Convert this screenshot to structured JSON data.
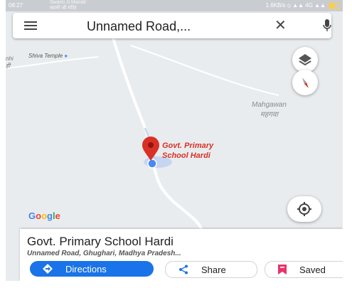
{
  "status_bar": {
    "notification_line1": "Swami Ji Mandir",
    "notification_line2": "स्वामी जी मंदिर",
    "left_text": "08:27",
    "right_text": "1.6KB/s ⦸ ▲▲ 4G ▲▲"
  },
  "search": {
    "query": "Unnamed Road,...",
    "menu_icon": "hamburger-menu-icon",
    "close_icon": "close-icon",
    "mic_icon": "microphone-icon"
  },
  "map": {
    "labels": {
      "shiva_temple": "Shiva Temple",
      "nhi_left": "nhi",
      "nhi_left_hindi": "ही",
      "mahgawan": "Mahgawan",
      "mahgawan_hindi": "महगवा",
      "school_line1": "Govt. Primary",
      "school_line2": "School Hardi"
    },
    "google_logo": {
      "letters": [
        "G",
        "o",
        "o",
        "g",
        "l",
        "e"
      ],
      "colors": [
        "#4285F4",
        "#EA4335",
        "#FBBC05",
        "#4285F4",
        "#34A853",
        "#EA4335"
      ]
    }
  },
  "place": {
    "title": "Govt. Primary School Hardi",
    "address": "Unnamed Road, Ghughari, Madhya Pradesh..."
  },
  "actions": {
    "directions": "Directions",
    "share": "Share",
    "saved": "Saved"
  },
  "colors": {
    "accent": "#1a73e8",
    "pin": "#d93025",
    "map_bg": "#e9ecee",
    "road": "#ffffff"
  }
}
